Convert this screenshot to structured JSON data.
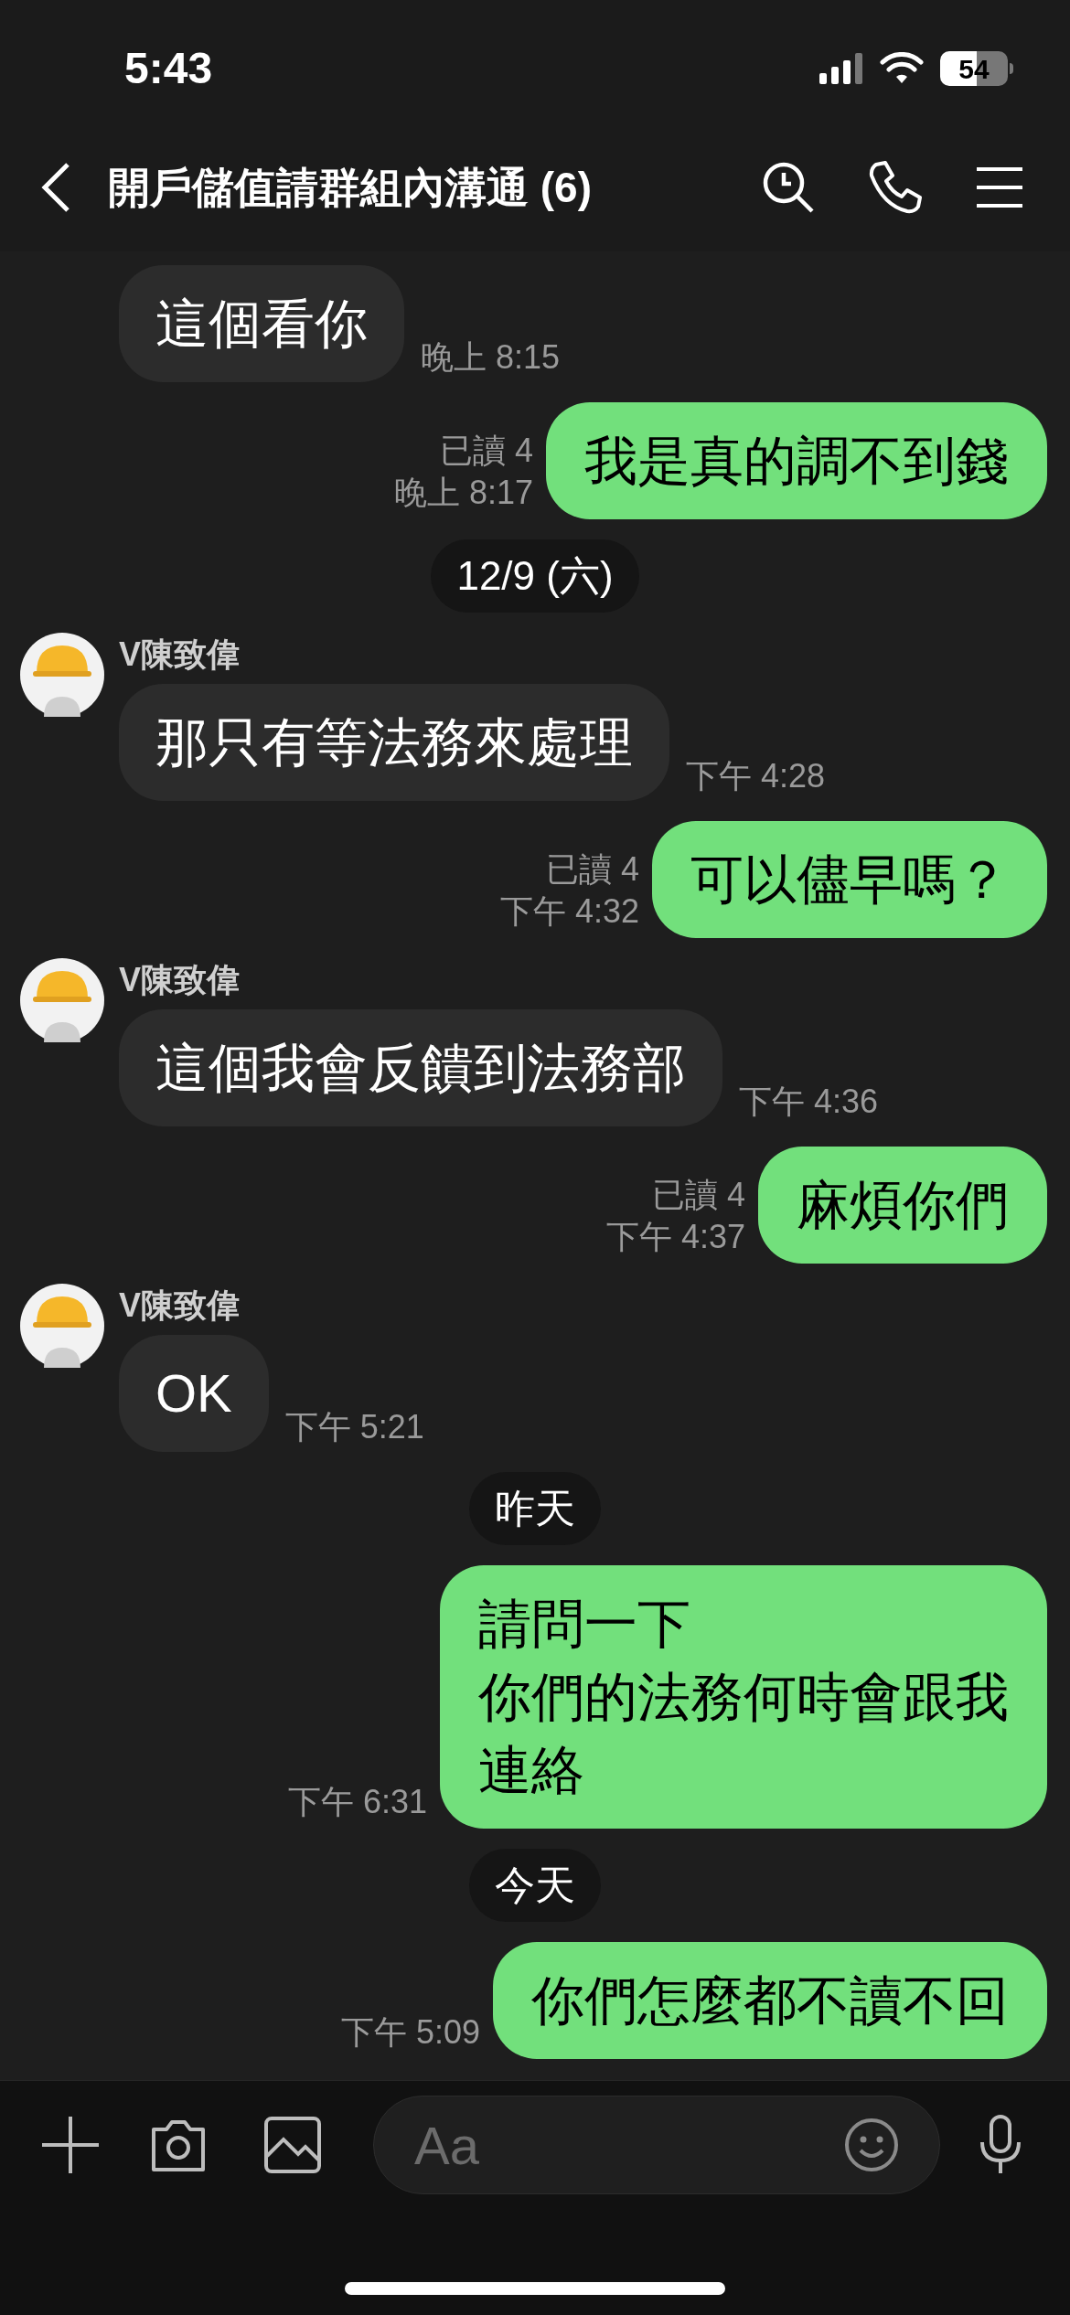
{
  "status_bar": {
    "time": "5:43",
    "battery": "54"
  },
  "header": {
    "title": "開戶儲值請群組內溝通 (6)"
  },
  "messages": [
    {
      "kind": "received",
      "text": "這個看你",
      "time": "晚上 8:15"
    },
    {
      "kind": "sent",
      "text": "我是真的調不到錢",
      "read": "已讀 4",
      "time": "晚上 8:17"
    },
    {
      "kind": "date",
      "text": "12/9 (六)"
    },
    {
      "kind": "received",
      "sender": "V陳致偉",
      "text": "那只有等法務來處理",
      "time": "下午 4:28"
    },
    {
      "kind": "sent",
      "text": "可以儘早嗎？",
      "read": "已讀 4",
      "time": "下午 4:32"
    },
    {
      "kind": "received",
      "sender": "V陳致偉",
      "text": "這個我會反饋到法務部",
      "time": "下午 4:36"
    },
    {
      "kind": "sent",
      "text": "麻煩你們",
      "read": "已讀 4",
      "time": "下午 4:37"
    },
    {
      "kind": "received",
      "sender": "V陳致偉",
      "text": "OK",
      "time": "下午 5:21"
    },
    {
      "kind": "date",
      "text": "昨天"
    },
    {
      "kind": "sent",
      "lines": [
        "請問一下",
        "你們的法務何時會跟我",
        "連絡"
      ],
      "time": "下午 6:31"
    },
    {
      "kind": "date",
      "text": "今天"
    },
    {
      "kind": "sent",
      "text": "你們怎麼都不讀不回",
      "time": "下午 5:09"
    }
  ],
  "input": {
    "placeholder": "Aa"
  }
}
